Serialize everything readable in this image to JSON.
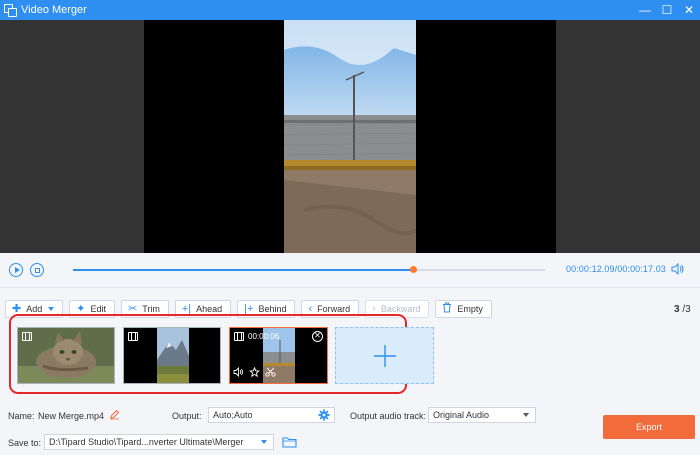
{
  "window": {
    "title": "Video Merger",
    "controls": [
      "minimize",
      "maximize",
      "close"
    ]
  },
  "playback": {
    "current_time": "00:00:12.09",
    "separator": "/",
    "total_time": "00:00:17.03",
    "progress_fraction": 0.72
  },
  "toolbar": {
    "add_label": "Add",
    "edit_label": "Edit",
    "trim_label": "Trim",
    "ahead_label": "Ahead",
    "behind_label": "Behind",
    "forward_label": "Forward",
    "backward_label": "Backward",
    "empty_label": "Empty",
    "page_current": "3",
    "page_total": "3"
  },
  "clips": [
    {
      "thumbnail": "kitten"
    },
    {
      "thumbnail": "mountain-landscape"
    },
    {
      "thumbnail": "fence-video",
      "duration": "00:00:06",
      "selected": true
    }
  ],
  "bottom": {
    "name_label": "Name:",
    "name_value": "New Merge.mp4",
    "output_label": "Output:",
    "output_value": "Auto;Auto",
    "audio_label": "Output audio track:",
    "audio_value": "Original Audio",
    "save_label": "Save to:",
    "save_path": "D:\\Tipard Studio\\Tipard...nverter Ultimate\\Merger",
    "export_label": "Export"
  },
  "colors": {
    "accent": "#2e8ff0",
    "export": "#f26b3a",
    "highlight": "#e5262c"
  }
}
